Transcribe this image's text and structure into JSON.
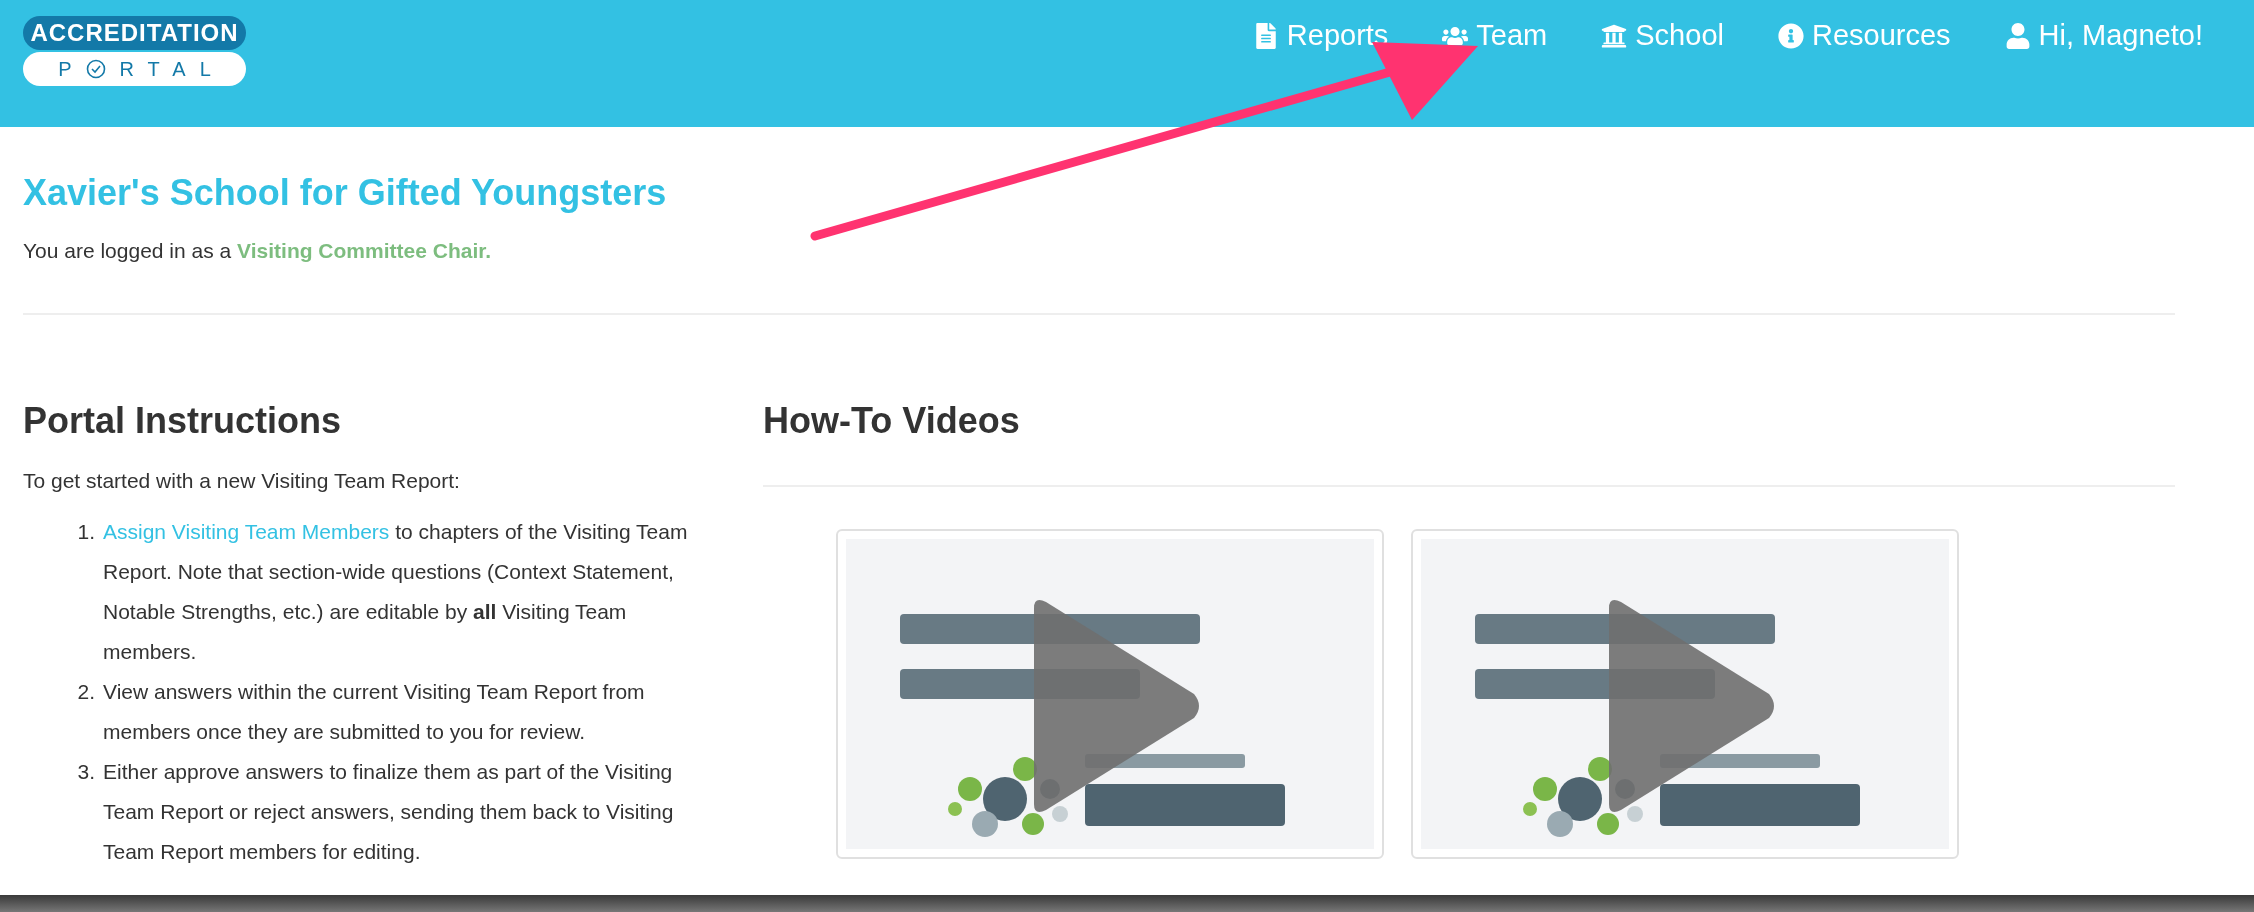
{
  "header": {
    "logo": {
      "line_1": "ACCREDITATION",
      "line_2_start": "P",
      "line_2_end": "RTAL"
    },
    "nav": [
      {
        "label": "Reports",
        "kind": "file"
      },
      {
        "label": "Team",
        "kind": "team"
      },
      {
        "label": "School",
        "kind": "building"
      },
      {
        "label": "Resources",
        "kind": "info"
      },
      {
        "label": "Hi, Magneto!",
        "kind": "user"
      }
    ]
  },
  "school": {
    "title": "Xavier's School for Gifted Youngsters",
    "login_text": "You are logged in as a",
    "role": "Visiting Committee Chair."
  },
  "instructions": {
    "heading": "Portal Instructions",
    "intro": "To get started with a new Visiting Team Report:",
    "steps": [
      {
        "number": "1.",
        "link": "Assign Visiting Team Members",
        "text": " to chapters of the Visiting Team Report. Note that section-wide questions (Context Statement, Notable Strengths, etc.) are editable by **all** Visiting Team members."
      },
      {
        "number": "2.",
        "text": "View answers within the current Visiting Team Report from members once they are submitted to you for review."
      },
      {
        "number": "3.",
        "text": "Either approve answers to finalize them as part of the Visiting Team Report or reject answers, sending them back to Visiting Team Report members for editing."
      }
    ]
  },
  "videos": {
    "heading": "How-To Videos"
  }
}
